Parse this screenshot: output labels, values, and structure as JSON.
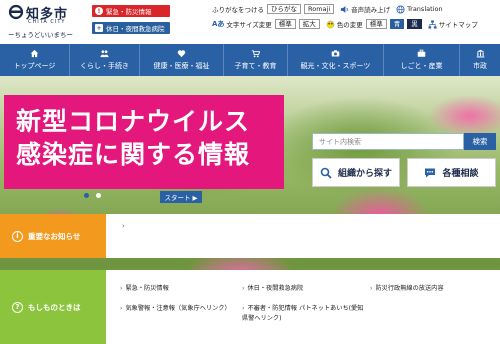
{
  "header": {
    "logo_name": "知多市",
    "logo_en": "CHITA CITY",
    "logo_tagline": "ーちょうどいいまちー",
    "emergency_label": "緊急・防災情報",
    "night_medical_label": "休日・夜間救急病院",
    "furigana_label": "ふりがなをつける",
    "hiragana_label": "ひらがな",
    "romaji_label": "Romaji",
    "voice_label": "音声読み上げ",
    "translation_label": "Translation",
    "font_size_label": "文字サイズ変更",
    "font_standard": "標準",
    "font_large": "拡大",
    "color_label": "色の変更",
    "color_standard": "標準",
    "color_blue": "青",
    "color_black": "黒",
    "sitemap_label": "サイトマップ"
  },
  "nav": {
    "items": [
      {
        "label": "トップページ",
        "icon": "home-icon"
      },
      {
        "label": "くらし・手続き",
        "icon": "people-icon"
      },
      {
        "label": "健康・医療・福祉",
        "icon": "heart-icon"
      },
      {
        "label": "子育て・教育",
        "icon": "stroller-icon"
      },
      {
        "label": "観光・文化・スポーツ",
        "icon": "camera-icon"
      },
      {
        "label": "しごと・産業",
        "icon": "briefcase-icon"
      },
      {
        "label": "市政",
        "icon": "building-icon"
      }
    ]
  },
  "hero": {
    "covid_line1": "新型コロナウイルス",
    "covid_line2": "感染症に関する情報",
    "search_placeholder": "サイト内検索",
    "search_button": "検索",
    "org_search_label": "組織から探す",
    "consult_label": "各種相談",
    "start_label": "スタート ▶"
  },
  "notices": {
    "important_label": "重要なお知らせ",
    "important_item": "›",
    "emergency_title": "もしものときは",
    "emergency_links": [
      "緊急・防災情報",
      "休日・夜間救急病院",
      "防災行政無線の放送内容",
      "気象警報・注意報（気象庁へリンク）",
      "不審者・防犯情報 パトネットあいち(愛知県警へリンク)"
    ]
  },
  "colors": {
    "nav_blue": "#2a61a4",
    "emergency_red": "#d9262a",
    "covid_pink": "#e4177d",
    "important_orange": "#f39a1e",
    "emergency_green": "#8dc43d"
  }
}
